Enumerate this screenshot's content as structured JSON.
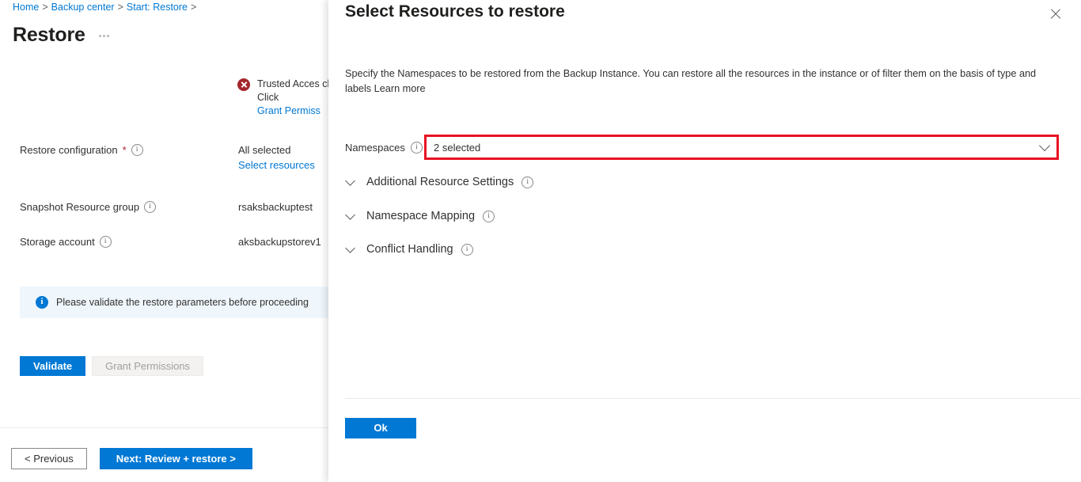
{
  "breadcrumb": {
    "items": [
      "Home",
      "Backup center",
      "Start: Restore"
    ],
    "separator": ">"
  },
  "page": {
    "title": "Restore",
    "more_menu_icon": "ellipsis-icon"
  },
  "error_callout": {
    "icon": "error-circle-icon",
    "text": "Trusted Acces cluster. Click ",
    "link_label": "Grant Permiss"
  },
  "form": {
    "rows": [
      {
        "label": "Restore configuration",
        "required": "*",
        "info_icon": "info-icon",
        "value": "All selected",
        "link_label": "Select resources"
      },
      {
        "label": "Snapshot Resource group",
        "required": "",
        "info_icon": "info-icon",
        "value": "rsaksbackuptest",
        "link_label": ""
      },
      {
        "label": "Storage account",
        "required": "",
        "info_icon": "info-icon",
        "value": "aksbackupstorev1",
        "link_label": ""
      }
    ]
  },
  "info_banner": {
    "icon": "info-filled-icon",
    "text": "Please validate the restore parameters before proceeding"
  },
  "actions": {
    "validate_label": "Validate",
    "grant_permissions_label": "Grant Permissions"
  },
  "footer": {
    "previous_label": "< Previous",
    "next_label": "Next: Review + restore >"
  },
  "panel": {
    "title": "Select Resources to restore",
    "close_icon": "close-icon",
    "description": "Specify the Namespaces to be restored from the Backup Instance. You can restore all the resources in the instance or of filter them on the basis of type and labels Learn more",
    "namespaces": {
      "label": "Namespaces",
      "info_icon": "info-icon",
      "value": "2 selected",
      "chevron_icon": "chevron-down-icon",
      "highlight_color": "#e81123"
    },
    "sections": [
      {
        "label": "Additional Resource Settings",
        "chevron_icon": "chevron-down-icon",
        "info_icon": "info-icon"
      },
      {
        "label": "Namespace Mapping",
        "chevron_icon": "chevron-down-icon",
        "info_icon": "info-icon"
      },
      {
        "label": "Conflict Handling",
        "chevron_icon": "chevron-down-icon",
        "info_icon": "info-icon"
      }
    ],
    "ok_label": "Ok"
  },
  "colors": {
    "accent": "#0078d4",
    "error": "#a4262c",
    "highlight": "#e81123",
    "info_bg": "#eff6fc"
  }
}
